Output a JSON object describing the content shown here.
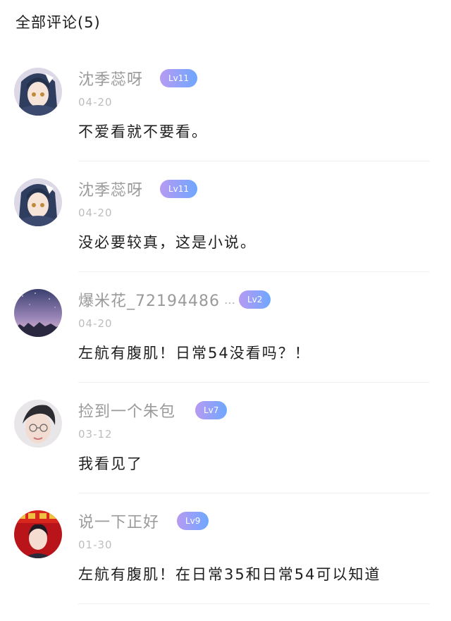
{
  "header": {
    "title": "全部评论(5)"
  },
  "comments": [
    {
      "username": "沈季蕊呀",
      "badge": "Lv11",
      "date": "04-20",
      "text": "不爱看就不要看。",
      "avatar": "anime-girl-avatar"
    },
    {
      "username": "沈季蕊呀",
      "badge": "Lv11",
      "date": "04-20",
      "text": "没必要较真，这是小说。",
      "avatar": "anime-girl-avatar"
    },
    {
      "username": "爆米花_72194486",
      "ellipsis": "…",
      "badge": "Lv2",
      "date": "04-20",
      "text": "左航有腹肌！日常54没看吗？！",
      "avatar": "night-sky-avatar"
    },
    {
      "username": "捡到一个朱包",
      "badge": "Lv7",
      "date": "03-12",
      "text": "我看见了",
      "avatar": "boy-portrait-avatar"
    },
    {
      "username": "说一下正好",
      "badge": "Lv9",
      "date": "01-30",
      "text": "左航有腹肌！在日常35和日常54可以知道",
      "avatar": "red-poster-avatar"
    }
  ],
  "colors": {
    "badge_start": "#b79af2",
    "badge_end": "#6ea7ff",
    "username": "#9a9a9a",
    "date": "#bdbdbd"
  }
}
